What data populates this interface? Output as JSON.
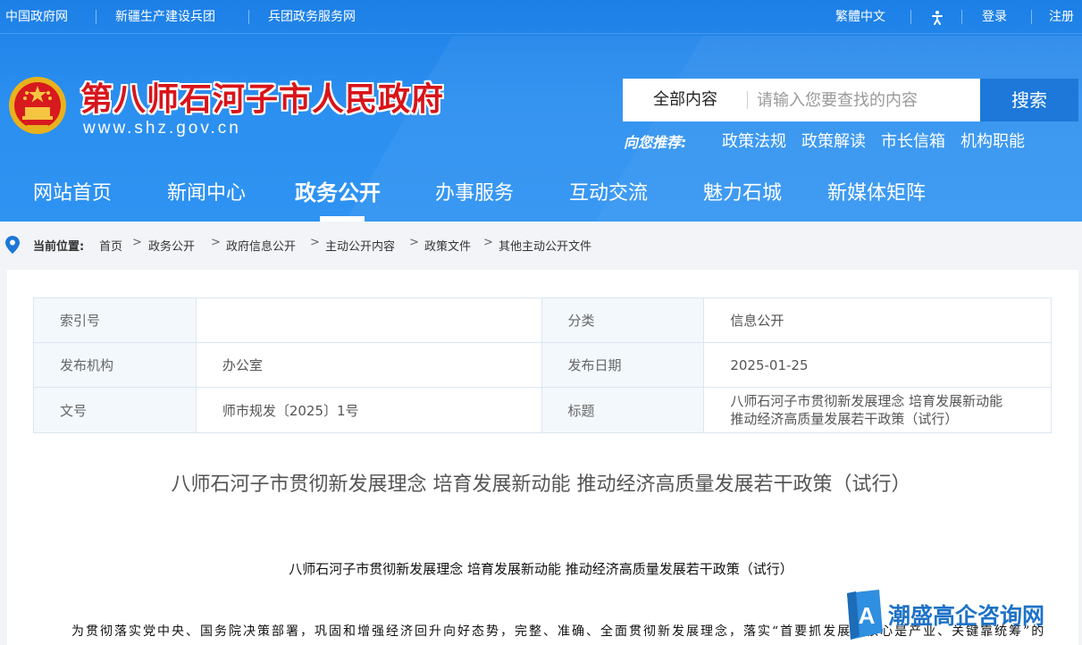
{
  "topbar": {
    "links_left": [
      "中国政府网",
      "新疆生产建设兵团",
      "兵团政务服务网"
    ],
    "traditional": "繁體中文",
    "login": "登录",
    "register": "注册"
  },
  "site": {
    "title": "第八师石河子市人民政府",
    "url": "www.shz.gov.cn"
  },
  "search": {
    "scope": "全部内容",
    "placeholder": "请输入您要查找的内容",
    "button": "搜索"
  },
  "recommend": {
    "label": "向您推荐:",
    "links": [
      "政策法规",
      "政策解读",
      "市长信箱",
      "机构职能"
    ]
  },
  "nav": {
    "items": [
      "网站首页",
      "新闻中心",
      "政务公开",
      "办事服务",
      "互动交流",
      "魅力石城",
      "新媒体矩阵"
    ],
    "active_index": 2
  },
  "breadcrumb": {
    "label": "当前位置:",
    "items": [
      "首页",
      "政务公开",
      "政府信息公开",
      "主动公开内容",
      "政策文件",
      "其他主动公开文件"
    ]
  },
  "meta": {
    "index_label": "索引号",
    "index_value": "",
    "category_label": "分类",
    "category_value": "信息公开",
    "org_label": "发布机构",
    "org_value": "办公室",
    "date_label": "发布日期",
    "date_value": "2025-01-25",
    "docno_label": "文号",
    "docno_value": "师市规发〔2025〕1号",
    "title_label": "标题",
    "title_value_line1": "八师石河子市贯彻新发展理念 培育发展新动能",
    "title_value_line2": "推动经济高质量发展若干政策（试行）"
  },
  "article": {
    "title": "八师石河子市贯彻新发展理念 培育发展新动能 推动经济高质量发展若干政策（试行）",
    "inner_title": "八师石河子市贯彻新发展理念 培育发展新动能 推动经济高质量发展若干政策（试行）",
    "body_first_line": "为贯彻落实党中央、国务院决策部署，巩固和增强经济回升向好态势，完整、准确、全面贯彻新发展理念，落实“首要抓发展，核心是产业、关键靠统筹”的"
  },
  "watermark": {
    "text": "潮盛高企咨询网",
    "logo_letter": "A"
  },
  "colors": {
    "header_blue": "#2b8ff0",
    "title_red": "#d8141a",
    "search_button": "#1d78d9"
  }
}
